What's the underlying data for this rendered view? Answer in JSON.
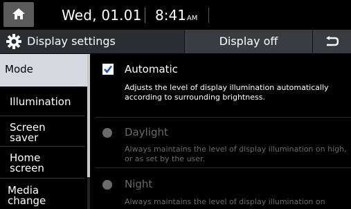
{
  "status_bar": {
    "date": "Wed, 01.01",
    "time": "8:41",
    "ampm": "AM"
  },
  "header": {
    "title": "Display settings",
    "display_off_label": "Display off"
  },
  "sidebar": {
    "items": [
      {
        "label": "Mode",
        "active": true
      },
      {
        "label": "Illumination",
        "active": false
      },
      {
        "label": "Screen\nsaver",
        "active": false
      },
      {
        "label": "Home\nscreen",
        "active": false
      },
      {
        "label": "Media\nchange",
        "active": false
      }
    ]
  },
  "content": {
    "automatic": {
      "label": "Automatic",
      "checked": true,
      "description": "Adjusts the level of display illumination automatically according to surrounding brightness."
    },
    "daylight": {
      "label": "Daylight",
      "description": "Always maintains the level of display illumination on high, or as set by the user."
    },
    "night": {
      "label": "Night",
      "description": "Always maintains the level of display illumination on"
    }
  },
  "colors": {
    "active_tab_bg": "#d6d9e0",
    "header_bg": "#2b2d33",
    "checkbox_check": "#1a4fd0"
  },
  "icons": [
    "home-icon",
    "gear-icon",
    "back-icon",
    "checkmark-icon"
  ]
}
